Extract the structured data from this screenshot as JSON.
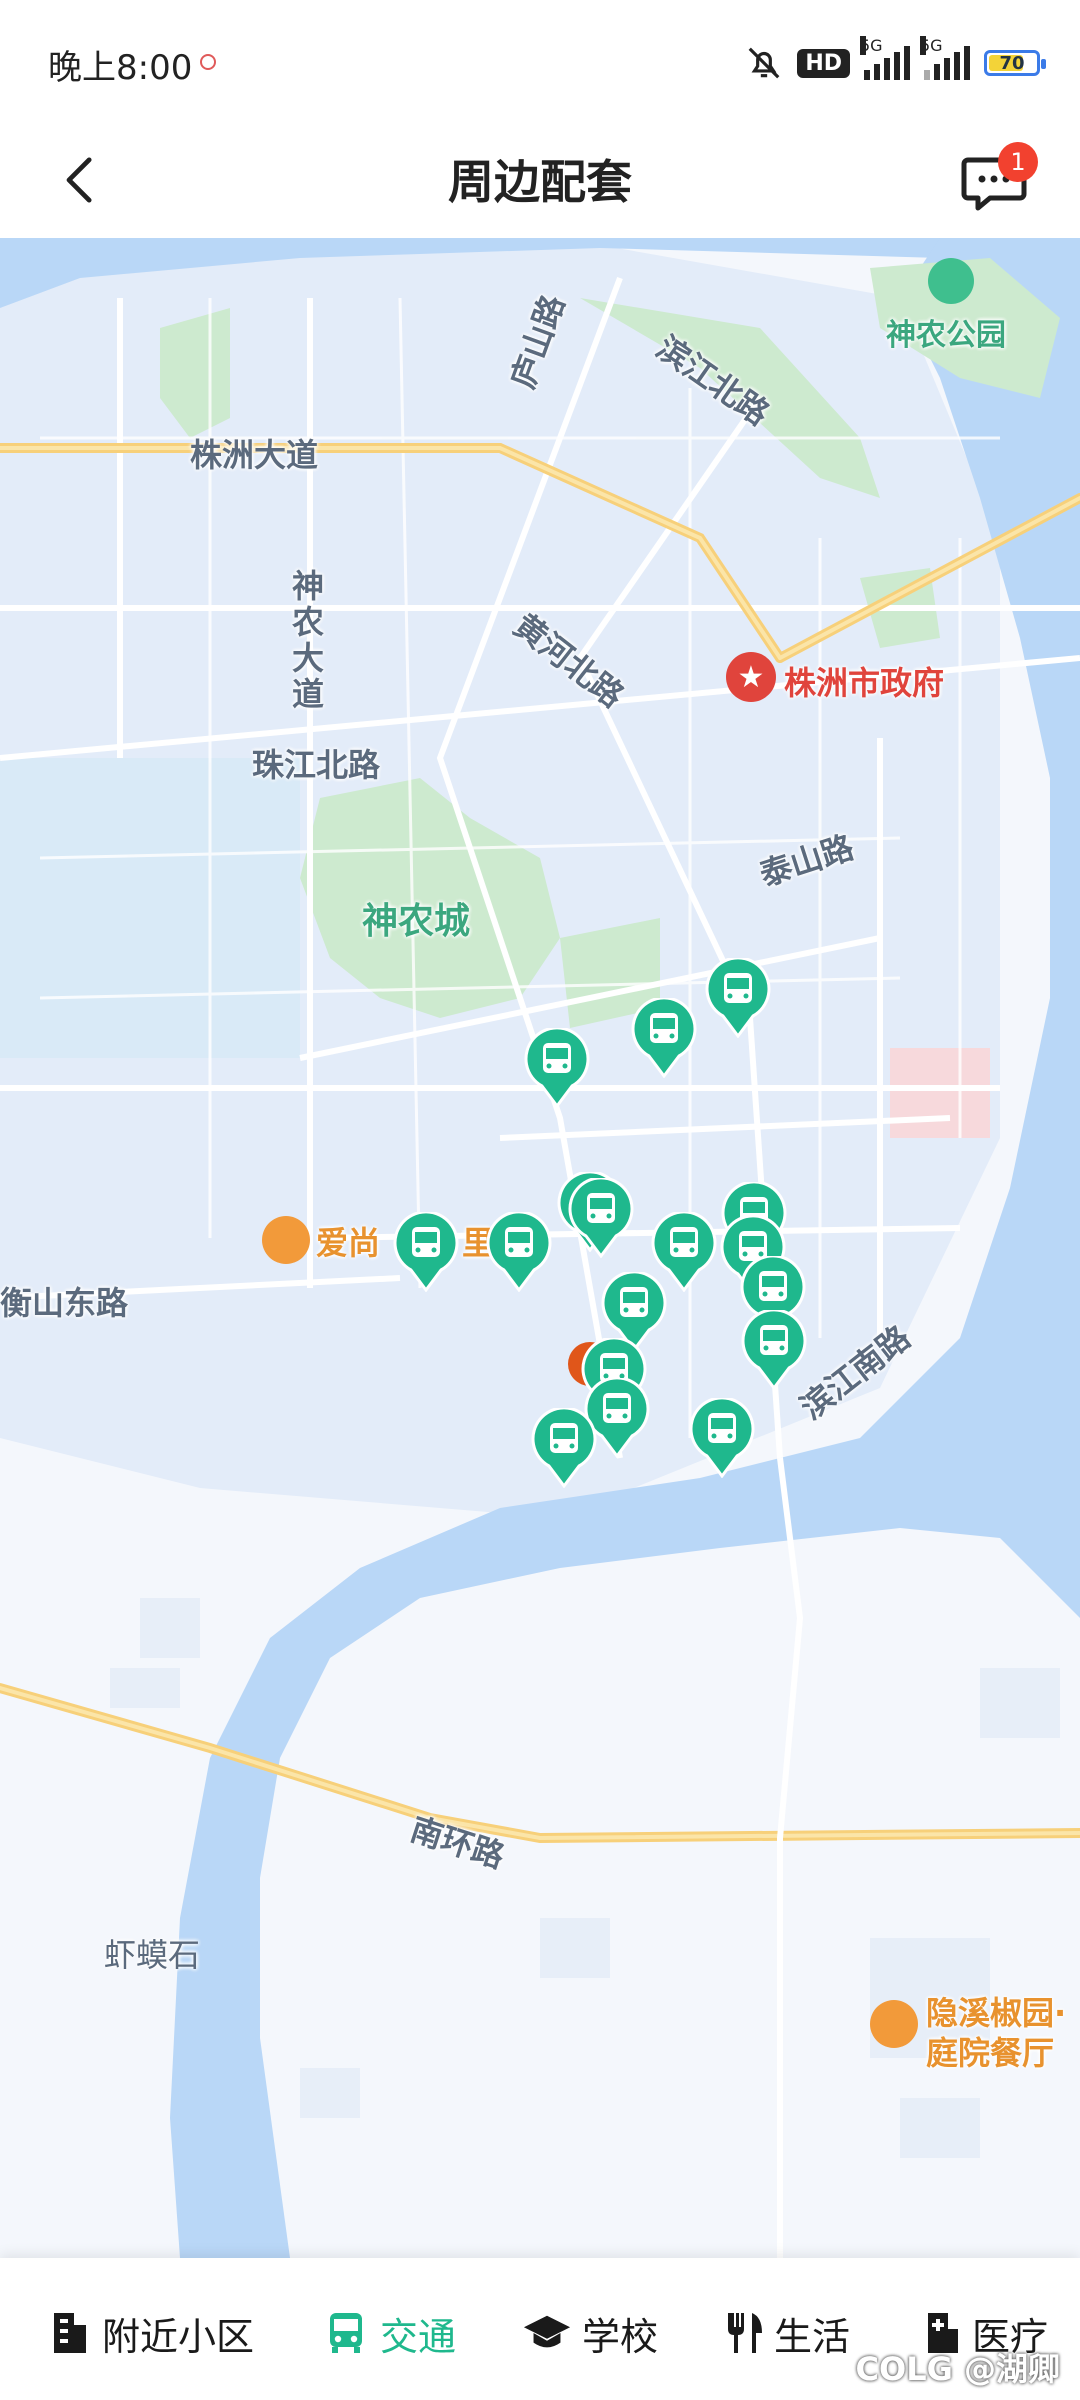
{
  "status_bar": {
    "time": "晚上8:00",
    "hd_label": "HD",
    "net_1": "5G",
    "net_2": "5G",
    "battery_level": "70"
  },
  "header": {
    "title": "周边配套",
    "message_badge": "1"
  },
  "map": {
    "place_labels": {
      "shennong_park": "神农公园",
      "lushan_road": "庐山路",
      "binjiang_north": "滨江北路",
      "zhuzhou_avenue": "株洲大道",
      "shennong_avenue": "神农大道",
      "huanghe_north": "黄河北路",
      "city_gov": "株洲市政府",
      "zhujiang_north": "珠江北路",
      "taishan_road": "泰山路",
      "shennong_city": "神农城",
      "aishang_restaurant": "爱尚",
      "aishang_restaurant_tail": "里",
      "hengshan_east": "衡山东路",
      "binjiang_south": "滨江南路",
      "nanhuan_road": "南环路",
      "xiamashi": "虾蟆石",
      "yinxi_restaurant_1": "隐溪椒园·",
      "yinxi_restaurant_2": "庭院餐厅"
    },
    "accent_color": "#1fb88d"
  },
  "bottom_nav": {
    "tabs": [
      {
        "label": "附近小区",
        "icon": "building-icon"
      },
      {
        "label": "交通",
        "icon": "bus-icon",
        "active": true
      },
      {
        "label": "学校",
        "icon": "graduation-cap-icon"
      },
      {
        "label": "生活",
        "icon": "fork-knife-icon"
      },
      {
        "label": "医疗",
        "icon": "medical-icon"
      }
    ]
  },
  "watermark": "COLG @湖卿"
}
